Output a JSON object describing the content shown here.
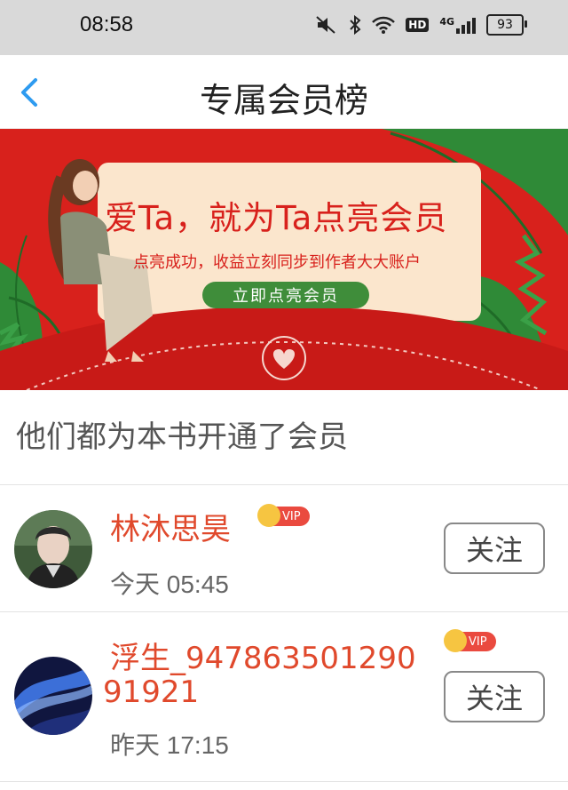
{
  "status_bar": {
    "time": "08:58",
    "network": "4G",
    "hd_label": "HD",
    "battery": "93"
  },
  "nav": {
    "title": "专属会员榜"
  },
  "banner": {
    "headline": "爱Ta，就为Ta点亮会员",
    "subtitle": "点亮成功，收益立刻同步到作者大大账户",
    "cta_label": "立即点亮会员",
    "colors": {
      "background": "#d8211c",
      "card": "#fbe6cd",
      "cta": "#3f8d3a",
      "leaf": "#2f8a37"
    }
  },
  "section": {
    "title": "他们都为本书开通了会员"
  },
  "members": [
    {
      "name": "林沐思昊",
      "badge": "VIP",
      "time": "今天 05:45",
      "follow_label": "关注"
    },
    {
      "name_line1": "浮生_947863501290",
      "name_line2": "91921",
      "badge": "VIP",
      "time": "昨天 17:15",
      "follow_label": "关注"
    }
  ],
  "colors": {
    "accent_name": "#e0492c",
    "vip": "#ea4a3f",
    "back_arrow": "#2e9bf0"
  }
}
